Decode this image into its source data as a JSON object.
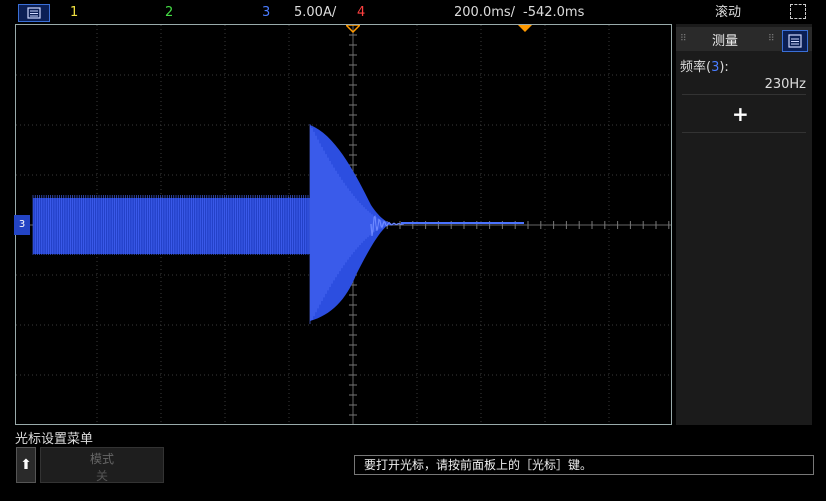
{
  "topbar": {
    "ch1": "1",
    "ch2": "2",
    "ch3": "3",
    "scale": "5.00A/",
    "ch4": "4",
    "timebase": "200.0ms/",
    "delay": "-542.0ms",
    "mode": "滚动",
    "colors": {
      "ch1": "#f0e040",
      "ch2": "#44dd44",
      "ch3": "#4a7cff",
      "ch4": "#ff4040",
      "trigger": "#ff9900"
    }
  },
  "side_panel": {
    "title": "测量",
    "measure_label_pre": "频率(",
    "measure_channel": "3",
    "measure_label_post": "):",
    "measure_value": "230Hz",
    "add_label": "+"
  },
  "waveform": {
    "channel_marker": "3",
    "color": "#3a5dff"
  },
  "bottom": {
    "menu_title": "光标设置菜单",
    "up_icon": "⬆",
    "softkey_line1": "模式",
    "softkey_line2": "关",
    "message": "要打开光标，请按前面板上的［光标］键。"
  }
}
